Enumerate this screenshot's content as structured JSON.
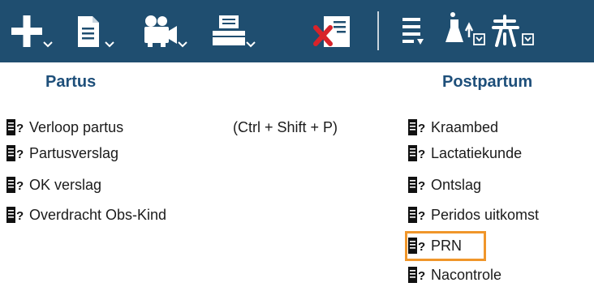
{
  "toolbar": {
    "buttons": [
      {
        "icon": "add-icon",
        "has_dropdown": true
      },
      {
        "icon": "document-icon",
        "has_dropdown": true
      },
      {
        "icon": "video-camera-icon",
        "has_dropdown": true
      },
      {
        "icon": "printer-icon",
        "has_dropdown": true
      },
      {
        "icon": "cancel-form-icon",
        "has_dropdown": false
      },
      {
        "icon": "list-download-icon",
        "has_dropdown": false
      },
      {
        "icon": "lab-flask-icon",
        "has_dropdown": true
      },
      {
        "icon": "pedigree-icon",
        "has_dropdown": true
      }
    ],
    "background": "#1f4e70"
  },
  "partus": {
    "title": "Partus",
    "items": [
      {
        "label": "Verloop partus",
        "shortcut": "(Ctrl + Shift + P)"
      },
      {
        "label": "Partusverslag"
      },
      {
        "label": "OK verslag"
      },
      {
        "label": "Overdracht Obs-Kind"
      }
    ]
  },
  "postpartum": {
    "title": "Postpartum",
    "items": [
      {
        "label": "Kraambed"
      },
      {
        "label": "Lactatiekunde"
      },
      {
        "label": "Ontslag"
      },
      {
        "label": "Peridos uitkomst"
      },
      {
        "label": "PRN",
        "highlighted": true
      },
      {
        "label": "Nacontrole"
      }
    ]
  },
  "colors": {
    "section_title": "#1e4f7a",
    "highlight": "#f0962a"
  }
}
